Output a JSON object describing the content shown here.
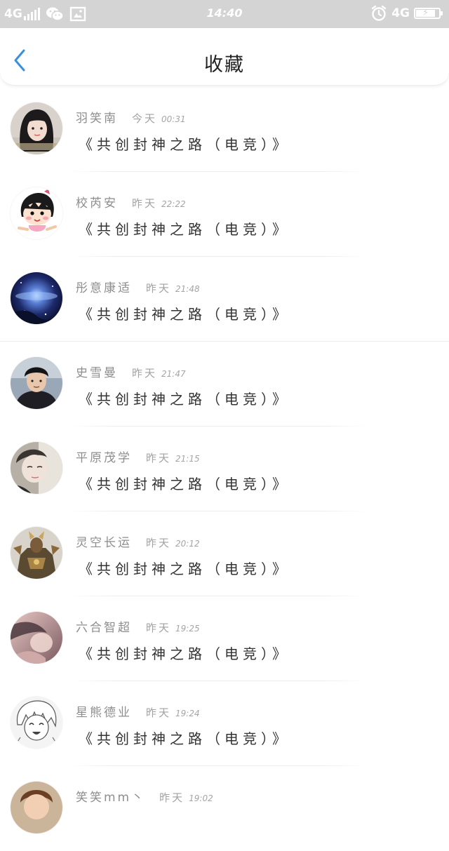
{
  "status_bar": {
    "network_left": "4G",
    "time": "14:40",
    "network_right": "4G",
    "icons": [
      "signal-icon",
      "wechat-icon",
      "gallery-icon",
      "alarm-icon",
      "battery-icon"
    ],
    "battery_level": 0.85
  },
  "header": {
    "back_icon": "chevron-left-icon",
    "title": "收藏",
    "accent_color": "#3a8fe0"
  },
  "items": [
    {
      "user": "羽笑南",
      "date": "今天",
      "time": "00:31",
      "title": "《共创封神之路（电竞）》",
      "avatar": "avatar-girl-portrait"
    },
    {
      "user": "校芮安",
      "date": "昨天",
      "time": "22:22",
      "title": "《共创封神之路（电竞）》",
      "avatar": "avatar-cartoon-girl"
    },
    {
      "user": "彤意康适",
      "date": "昨天",
      "time": "21:48",
      "title": "《共创封神之路（电竞）》",
      "avatar": "avatar-galaxy"
    },
    {
      "user": "史雪曼",
      "date": "昨天",
      "time": "21:47",
      "title": "《共创封神之路（电竞）》",
      "avatar": "avatar-boy-photo"
    },
    {
      "user": "平原茂学",
      "date": "昨天",
      "time": "21:15",
      "title": "《共创封神之路（电竞）》",
      "avatar": "avatar-face-closeup"
    },
    {
      "user": "灵空长运",
      "date": "昨天",
      "time": "20:12",
      "title": "《共创封神之路（电竞）》",
      "avatar": "avatar-armored-warrior"
    },
    {
      "user": "六合智超",
      "date": "昨天",
      "time": "19:25",
      "title": "《共创封神之路（电竞）》",
      "avatar": "avatar-blurred-portrait"
    },
    {
      "user": "星熊德业",
      "date": "昨天",
      "time": "19:24",
      "title": "《共创封神之路（电竞）》",
      "avatar": "avatar-manga-sketch"
    },
    {
      "user": "笑笑mm丶",
      "date": "昨天",
      "time": "19:02",
      "title": "",
      "avatar": "avatar-boy-partial"
    }
  ]
}
